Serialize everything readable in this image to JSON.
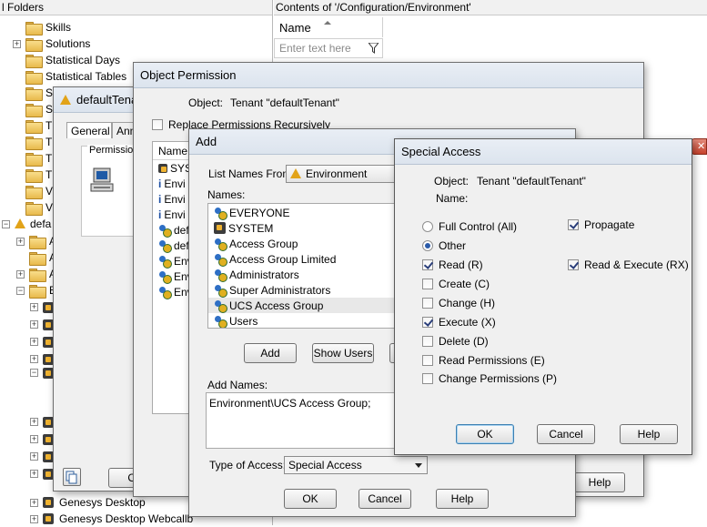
{
  "tree": {
    "header": "l Folders",
    "items": [
      {
        "label": "Skills"
      },
      {
        "label": "Solutions"
      },
      {
        "label": "Statistical Days"
      },
      {
        "label": "Statistical Tables"
      },
      {
        "label": "S"
      },
      {
        "label": "S"
      },
      {
        "label": "T"
      },
      {
        "label": "T"
      },
      {
        "label": "T"
      },
      {
        "label": "T"
      },
      {
        "label": "V"
      },
      {
        "label": "V"
      }
    ],
    "tenant_label": "defa",
    "sub_items": [
      {
        "label": "A"
      },
      {
        "label": "A"
      },
      {
        "label": "A"
      },
      {
        "label": "B"
      }
    ],
    "bottom_items": [
      {
        "label": "Genesys Desktop"
      },
      {
        "label": "Genesys Desktop Webcallb"
      }
    ]
  },
  "content": {
    "header": "Contents of '/Configuration/Environment'",
    "column_name": "Name",
    "filter_placeholder": "Enter text here"
  },
  "tenant_dialog": {
    "title": "defaultTena",
    "tabs": [
      "General",
      "Anni"
    ],
    "group_label": "Permission",
    "ok_label": "OK"
  },
  "object_permission": {
    "title": "Object Permission",
    "object_label": "Object:",
    "object_value": "Tenant \"defaultTenant\"",
    "replace_label": "Replace Permissions Recursively",
    "column_name": "Name",
    "rows": [
      "SYS",
      "Envi",
      "Envi",
      "Envi",
      "defa",
      "defa",
      "Envi",
      "Envi",
      "Envi"
    ],
    "help_label": "Help"
  },
  "add_dialog": {
    "title": "Add",
    "list_from_label": "List Names From:",
    "list_from_value": "Environment",
    "names_label": "Names:",
    "names": [
      {
        "label": "EVERYONE",
        "icon": "everyone-icon"
      },
      {
        "label": "SYSTEM",
        "icon": "system-icon"
      },
      {
        "label": "Access Group",
        "icon": "group-icon"
      },
      {
        "label": "Access Group Limited",
        "icon": "group-icon"
      },
      {
        "label": "Administrators",
        "icon": "group-icon"
      },
      {
        "label": "Super Administrators",
        "icon": "group-icon"
      },
      {
        "label": "UCS Access Group",
        "icon": "group-icon",
        "selected": true
      },
      {
        "label": "Users",
        "icon": "group-icon"
      }
    ],
    "add_button": "Add",
    "show_users_button": "Show Users",
    "add_names_label": "Add Names:",
    "add_names_value": "Environment\\UCS Access Group;",
    "type_of_access_label": "Type of Access:",
    "type_of_access_value": "Special Access",
    "ok_label": "OK",
    "cancel_label": "Cancel",
    "help_label": "Help"
  },
  "special_access": {
    "title": "Special Access",
    "object_label": "Object:",
    "object_value": "Tenant \"defaultTenant\"",
    "name_label": "Name:",
    "full_control_label": "Full Control (All)",
    "propagate_label": "Propagate",
    "propagate_checked": true,
    "other_label": "Other",
    "options": [
      {
        "label": "Read (R)",
        "checked": true
      },
      {
        "label": "Create (C)",
        "checked": false
      },
      {
        "label": "Change (H)",
        "checked": false
      },
      {
        "label": "Execute (X)",
        "checked": true
      },
      {
        "label": "Delete (D)",
        "checked": false
      },
      {
        "label": "Read Permissions (E)",
        "checked": false
      },
      {
        "label": "Change Permissions (P)",
        "checked": false
      }
    ],
    "read_execute_label": "Read & Execute (RX)",
    "read_execute_checked": true,
    "ok_label": "OK",
    "cancel_label": "Cancel",
    "help_label": "Help"
  }
}
